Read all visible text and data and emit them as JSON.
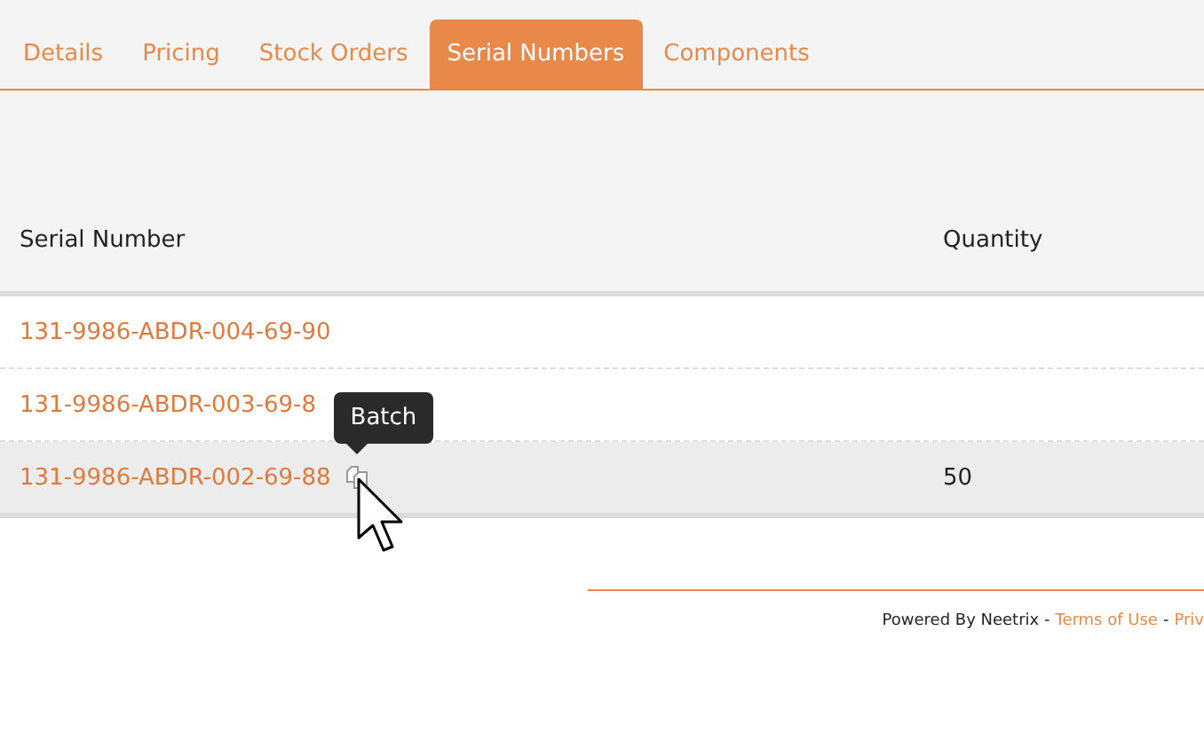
{
  "tabs": [
    {
      "label": "Details",
      "selected": false
    },
    {
      "label": "Pricing",
      "selected": false
    },
    {
      "label": "Stock Orders",
      "selected": false
    },
    {
      "label": "Serial Numbers",
      "selected": true
    },
    {
      "label": "Components",
      "selected": false
    }
  ],
  "table": {
    "columns": [
      "Serial Number",
      "Quantity"
    ],
    "rows": [
      {
        "serial": "131-9986-ABDR-004-69-90",
        "quantity": "",
        "selected": false,
        "batch": false
      },
      {
        "serial": "131-9986-ABDR-003-69-8",
        "quantity": "",
        "selected": false,
        "batch": false
      },
      {
        "serial": "131-9986-ABDR-002-69-88",
        "quantity": "50",
        "selected": true,
        "batch": true,
        "tooltip": "Batch"
      }
    ]
  },
  "footer": [
    {
      "kind": "text",
      "text": "Powered By Neetrix -"
    },
    {
      "kind": "link",
      "text": "Terms of Use"
    },
    {
      "kind": "text",
      "text": "-"
    },
    {
      "kind": "link",
      "text": "Priv"
    }
  ]
}
